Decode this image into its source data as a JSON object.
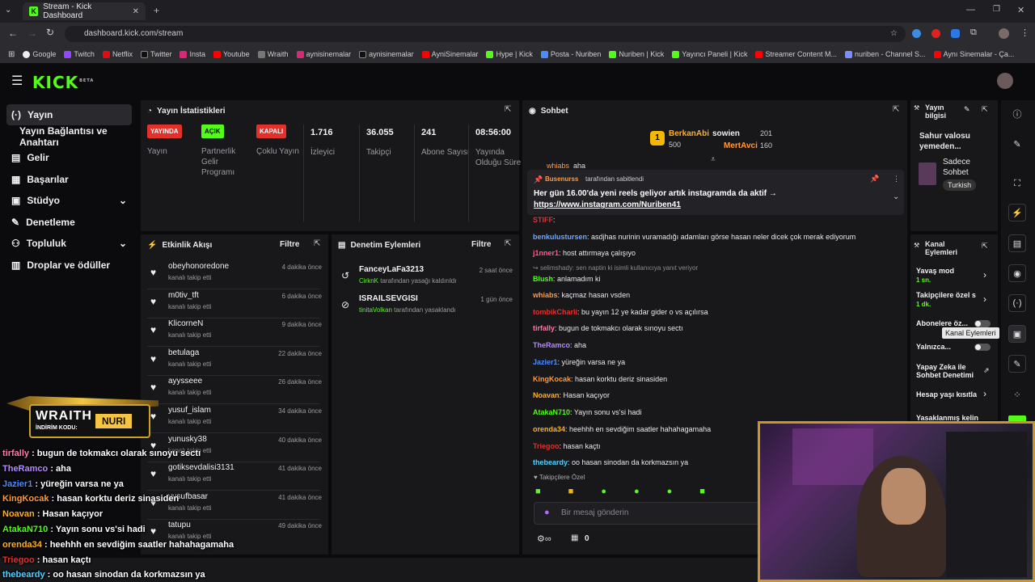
{
  "browser": {
    "tab_title": "Stream - Kick Dashboard",
    "url": "dashboard.kick.com/stream",
    "bookmarks": [
      "Google",
      "Twitch",
      "Netflix",
      "Twitter",
      "Insta",
      "Youtube",
      "Wraith",
      "aynisinemalar",
      "aynisinemalar",
      "AyniSinemalar",
      "Hype | Kick",
      "Posta - Nuriben",
      "Nuriben | Kick",
      "Yayıncı Paneli | Kick",
      "Streamer Content M...",
      "nuriben - Channel S...",
      "Aynı Sinemalar - Ça..."
    ]
  },
  "app": {
    "logo": "KICK",
    "beta": "BETA"
  },
  "sidebar": {
    "items": [
      {
        "label": "Yayın",
        "icon": "broadcast-icon"
      },
      {
        "label": "Yayın Bağlantısı ve Anahtarı"
      },
      {
        "label": "Gelir",
        "icon": "money-icon"
      },
      {
        "label": "Başarılar",
        "icon": "trophy-icon"
      },
      {
        "label": "Stüdyo",
        "icon": "studio-icon"
      },
      {
        "label": "Denetleme",
        "icon": "wrench-icon"
      },
      {
        "label": "Topluluk",
        "icon": "community-icon"
      },
      {
        "label": "Droplar ve ödüller",
        "icon": "gift-icon"
      }
    ]
  },
  "stats": {
    "title": "Yayın İstatistikleri",
    "items": [
      {
        "badge": "YAYINDA",
        "badge_color": "#e0312d",
        "label": "Yayın"
      },
      {
        "badge": "AÇIK",
        "badge_color": "#53fc18",
        "label": "Partnerlik Gelir Programı"
      },
      {
        "badge": "KAPALI",
        "badge_color": "#e0312d",
        "label": "Çoklu Yayın"
      },
      {
        "value": "1.716",
        "label": "İzleyici"
      },
      {
        "value": "36.055",
        "label": "Takipçi"
      },
      {
        "value": "241",
        "label": "Abone Sayısı"
      },
      {
        "value": "08:56:00",
        "label": "Yayında Olduğu Süre"
      }
    ]
  },
  "activity": {
    "title": "Etkinlik Akışı",
    "filter": "Filtre",
    "events": [
      {
        "name": "obeyhonoredone",
        "sub": "kanalı takip etti",
        "time": "4 dakika önce"
      },
      {
        "name": "m0tiv_tft",
        "sub": "kanalı takip etti",
        "time": "6 dakika önce"
      },
      {
        "name": "KlicorneN",
        "sub": "kanalı takip etti",
        "time": "9 dakika önce"
      },
      {
        "name": "betulaga",
        "sub": "kanalı takip etti",
        "time": "22 dakika önce"
      },
      {
        "name": "ayysseee",
        "sub": "kanalı takip etti",
        "time": "26 dakika önce"
      },
      {
        "name": "yusuf_islam",
        "sub": "kanalı takip etti",
        "time": "34 dakika önce"
      },
      {
        "name": "yunusky38",
        "sub": "kanalı takip etti",
        "time": "40 dakika önce"
      },
      {
        "name": "gotiksevdalisi3131",
        "sub": "kanalı takip etti",
        "time": "41 dakika önce"
      },
      {
        "name": "yusufbasar",
        "sub": "kanalı takip etti",
        "time": "41 dakika önce"
      },
      {
        "name": "tatupu",
        "sub": "kanalı takip etti",
        "time": "49 dakika önce"
      }
    ]
  },
  "moderation": {
    "title": "Denetim Eylemleri",
    "filter": "Filtre",
    "actions": [
      {
        "name": "FanceyLaFa3213",
        "actor": "CirknK",
        "text": "tarafından yasağı kaldırıldı",
        "time": "2 saat önce"
      },
      {
        "name": "ISRAILSEVGISI",
        "actor": "tinitaVolkan",
        "text": "tarafından yasaklandı",
        "time": "1 gün önce"
      }
    ]
  },
  "chat": {
    "title": "Sohbet",
    "top": [
      {
        "rank": "1",
        "name": "BerkanAbi",
        "amount": "500"
      },
      {
        "name": "sowien",
        "amount": "201"
      },
      {
        "name": "MertAvci",
        "amount": "160"
      }
    ],
    "peek_user": "whiabs",
    "peek_text": "aha",
    "pinned": {
      "by": "Busenurss",
      "by_suffix": "tarafından sabitlendi",
      "text": "Her gün 16.00'da yeni reels geliyor artık instagramda da aktif →",
      "link": "https://www.instagram.com/Nuriben41"
    },
    "messages": [
      {
        "user": "STIFF",
        "color": "#e0312d",
        "text": ""
      },
      {
        "user": "benkulustursen",
        "color": "#6fa8ff",
        "text": "asdjhas nurinin vuramadığı adamları görse hasan neler dicek çok merak ediyorum"
      },
      {
        "user": "j1nner1",
        "color": "#ff5c8a",
        "text": "host attırmaya çalışıyo"
      },
      {
        "user": "selimshady",
        "color": "#8a8a8a",
        "text": "sen naptin ki isimli kullanıcıya yanıt veriyor"
      },
      {
        "user": "Blush",
        "color": "#53fc18",
        "text": "anlamadım ki"
      },
      {
        "user": "whiabs",
        "color": "#ff9a3c",
        "text": "kaçmaz hasan vsden"
      },
      {
        "user": "tombikCharli",
        "color": "#e0312d",
        "text": "bu yayın 12 ye kadar gider o vs açılırsa"
      },
      {
        "user": "tirfally",
        "color": "#ff7aa8",
        "text": "bugun de tokmakcı olarak sınoyu sectı"
      },
      {
        "user": "TheRamco",
        "color": "#b68aff",
        "text": "aha"
      },
      {
        "user": "Jazier1",
        "color": "#4a8cff",
        "text": "yüreğin varsa ne ya"
      },
      {
        "user": "KingKocak",
        "color": "#ff9a3c",
        "text": "hasan korktu deriz sinasiden"
      },
      {
        "user": "Noavan",
        "color": "#ffb020",
        "text": "Hasan kaçıyor"
      },
      {
        "user": "AtakaN710",
        "color": "#53fc18",
        "text": "Yayın sonu vs'si hadi"
      },
      {
        "user": "orenda34",
        "color": "#ffb020",
        "text": "heehhh en sevdiğim saatler hahahagamaha"
      },
      {
        "user": "Triegoo",
        "color": "#e0312d",
        "text": "hasan kaçtı"
      },
      {
        "user": "thebeardy",
        "color": "#4fd0ff",
        "text": "oo hasan sinodan da korkmazsın ya"
      }
    ],
    "followers_only": "Takipçilere Özel",
    "input_placeholder": "Bir mesaj gönderin",
    "count": "0"
  },
  "stream_info": {
    "title": "Yayın bilgisi",
    "stream_title": "Sahur valosu yemeden...",
    "category": "Sadece Sohbet",
    "language": "Turkish"
  },
  "channel_actions": {
    "title": "Kanal Eylemleri",
    "tooltip": "Kanal Eylemleri",
    "items": [
      {
        "label": "Yavaş mod",
        "sub": "1 sn."
      },
      {
        "label": "Takipçilere özel s",
        "sub": "1 dk."
      },
      {
        "label": "Abonelere öz..."
      },
      {
        "label": "Yalnızca..."
      },
      {
        "label": "Yapay Zeka ile Sohbet Denetimi"
      },
      {
        "label": "Hesap yaşı kısıtla"
      },
      {
        "label": "Yasaklanmış kelin"
      }
    ]
  },
  "overlay": {
    "ad_brand": "WRAITH",
    "ad_code_label": "İNDİRİM KODU:",
    "ad_code": "NURI",
    "lines": [
      {
        "user": "tirfally",
        "color": "#ff7aa8",
        "text": ": bugun de tokmakcı olarak sınoyu sectı"
      },
      {
        "user": "TheRamco",
        "color": "#b68aff",
        "text": ": aha"
      },
      {
        "user": "Jazier1",
        "color": "#4a8cff",
        "text": ": yüreğin varsa ne ya"
      },
      {
        "user": "KingKocak",
        "color": "#ff9a3c",
        "text": ": hasan korktu deriz sinasiden"
      },
      {
        "user": "Noavan",
        "color": "#ffb020",
        "text": ": Hasan kaçıyor"
      },
      {
        "user": "AtakaN710",
        "color": "#53fc18",
        "text": ": Yayın sonu vs'si hadi"
      },
      {
        "user": "orenda34",
        "color": "#ffb020",
        "text": ": heehhh en sevdiğim saatler hahahagamaha"
      },
      {
        "user": "Triegoo",
        "color": "#e0312d",
        "text": ": hasan kaçtı"
      },
      {
        "user": "thebeardy",
        "color": "#4fd0ff",
        "text": ": oo hasan sinodan da korkmazsın ya"
      }
    ]
  }
}
